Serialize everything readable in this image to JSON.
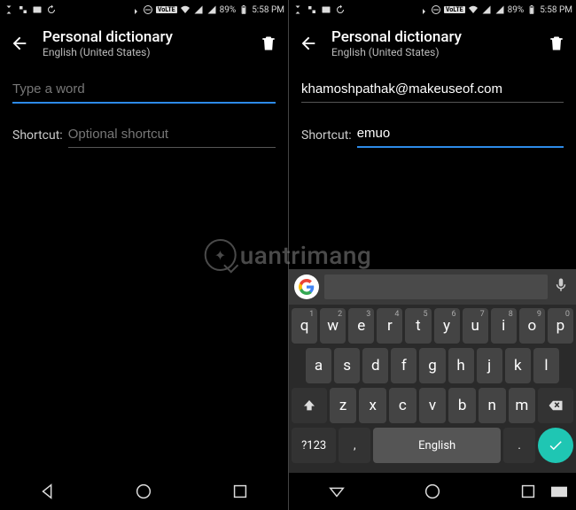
{
  "status": {
    "battery": "89%",
    "time": "5:58 PM"
  },
  "toolbar": {
    "title": "Personal dictionary",
    "subtitle": "English (United States)"
  },
  "left": {
    "word_placeholder": "Type a word",
    "word_value": "",
    "shortcut_label": "Shortcut:",
    "shortcut_placeholder": "Optional shortcut",
    "shortcut_value": ""
  },
  "right": {
    "word_value": "khamoshpathak@makeuseof.com",
    "shortcut_label": "Shortcut:",
    "shortcut_value": "emuo"
  },
  "keyboard": {
    "row1": [
      "q",
      "w",
      "e",
      "r",
      "t",
      "y",
      "u",
      "i",
      "o",
      "p"
    ],
    "row1sup": [
      "1",
      "2",
      "3",
      "4",
      "5",
      "6",
      "7",
      "8",
      "9",
      "0"
    ],
    "row2": [
      "a",
      "s",
      "d",
      "f",
      "g",
      "h",
      "j",
      "k",
      "l"
    ],
    "row3": [
      "z",
      "x",
      "c",
      "v",
      "b",
      "n",
      "m"
    ],
    "symkey": "?123",
    "comma": ",",
    "space": "English",
    "period": "."
  },
  "watermark": "uantrimang"
}
